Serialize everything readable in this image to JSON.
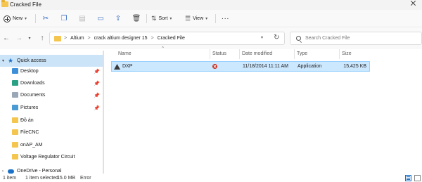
{
  "window": {
    "title": "Cracked File"
  },
  "toolbar": {
    "new_label": "New",
    "sort_label": "Sort",
    "view_label": "View",
    "more_label": "..."
  },
  "address": {
    "crumbs": [
      "Altium",
      "crack altium designer 15",
      "Cracked File"
    ],
    "separator": ">"
  },
  "search": {
    "placeholder": "Search Cracked File"
  },
  "sidebar": {
    "quick_access": "Quick access",
    "items": [
      {
        "label": "Desktop",
        "icon": "desktop-icon",
        "pinned": true
      },
      {
        "label": "Downloads",
        "icon": "downloads-icon",
        "pinned": true
      },
      {
        "label": "Documents",
        "icon": "documents-icon",
        "pinned": true
      },
      {
        "label": "Pictures",
        "icon": "pictures-icon",
        "pinned": true
      },
      {
        "label": "Đồ án",
        "icon": "folder-icon",
        "pinned": false
      },
      {
        "label": "FileCNC",
        "icon": "folder-icon",
        "pinned": false
      },
      {
        "label": "onAP_AM",
        "icon": "folder-icon",
        "pinned": false
      },
      {
        "label": "Voltage Regulator Circuit",
        "icon": "folder-icon",
        "pinned": false
      }
    ],
    "onedrive": "OneDrive - Personal"
  },
  "columns": {
    "name": "Name",
    "status": "Status",
    "date": "Date modified",
    "type": "Type",
    "size": "Size"
  },
  "files": [
    {
      "name": "DXP",
      "status": "error",
      "date": "11/18/2014 11:11 AM",
      "type": "Application",
      "size": "15,425 KB",
      "selected": true
    }
  ],
  "status": {
    "count": "1 item",
    "selected": "1 item selected",
    "size": "15.0 MB",
    "error": "Error"
  },
  "colors": {
    "selection": "#cce8ff",
    "accent": "#1b6ec2",
    "folder": "#f5c64f",
    "error": "#c42b1c"
  }
}
